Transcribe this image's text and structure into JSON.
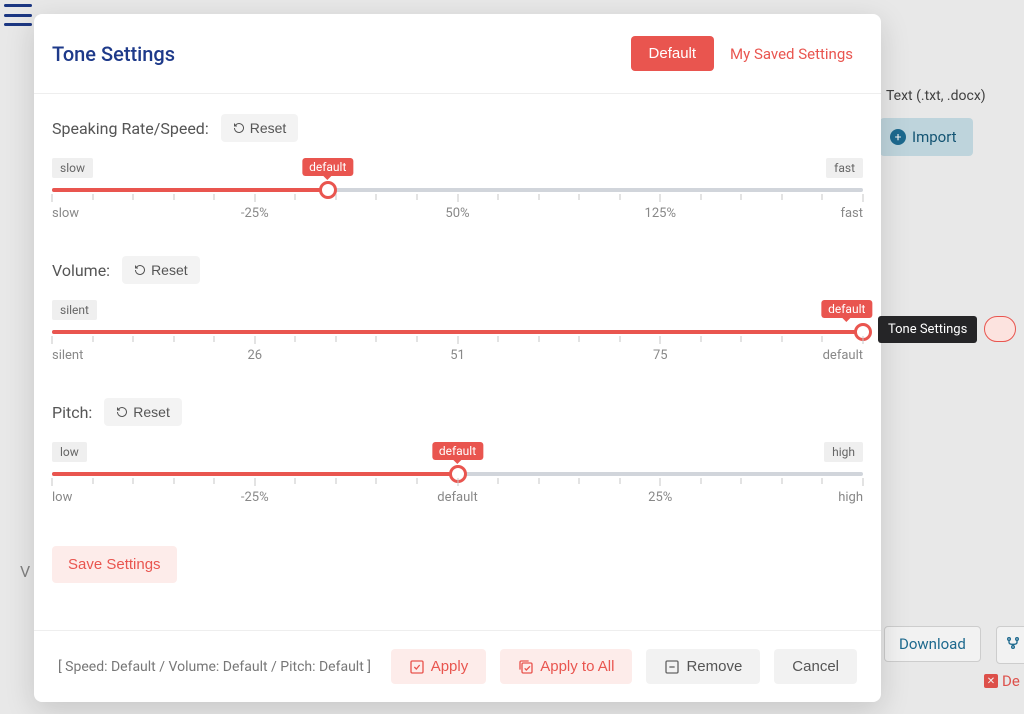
{
  "modal": {
    "title": "Tone Settings",
    "default_btn": "Default",
    "saved_link": "My Saved Settings"
  },
  "sliders": {
    "speed": {
      "label": "Speaking Rate/Speed:",
      "reset": "Reset",
      "left_cap": "slow",
      "right_cap": "fast",
      "bubble": "default",
      "bubble_pct": 34,
      "thumb_pct": 34,
      "scale": [
        "slow",
        "-25%",
        "50%",
        "125%",
        "fast"
      ]
    },
    "volume": {
      "label": "Volume:",
      "reset": "Reset",
      "left_cap": "silent",
      "right_cap": "default",
      "bubble": "default",
      "bubble_pct": 98,
      "thumb_pct": 100,
      "scale": [
        "silent",
        "26",
        "51",
        "75",
        "default"
      ]
    },
    "pitch": {
      "label": "Pitch:",
      "reset": "Reset",
      "left_cap": "low",
      "right_cap": "high",
      "bubble": "default",
      "bubble_pct": 50,
      "thumb_pct": 50,
      "scale": [
        "low",
        "-25%",
        "default",
        "25%",
        "high"
      ]
    }
  },
  "save_settings": "Save Settings",
  "footer": {
    "summary": "[ Speed: Default / Volume: Default / Pitch: Default ]",
    "apply": "Apply",
    "apply_all": "Apply to All",
    "remove": "Remove",
    "cancel": "Cancel"
  },
  "background": {
    "text_formats": "Text (.txt, .docx)",
    "import": "Import",
    "download": "Download",
    "de": "De",
    "v": "V",
    "tone_tooltip": "Tone Settings"
  }
}
